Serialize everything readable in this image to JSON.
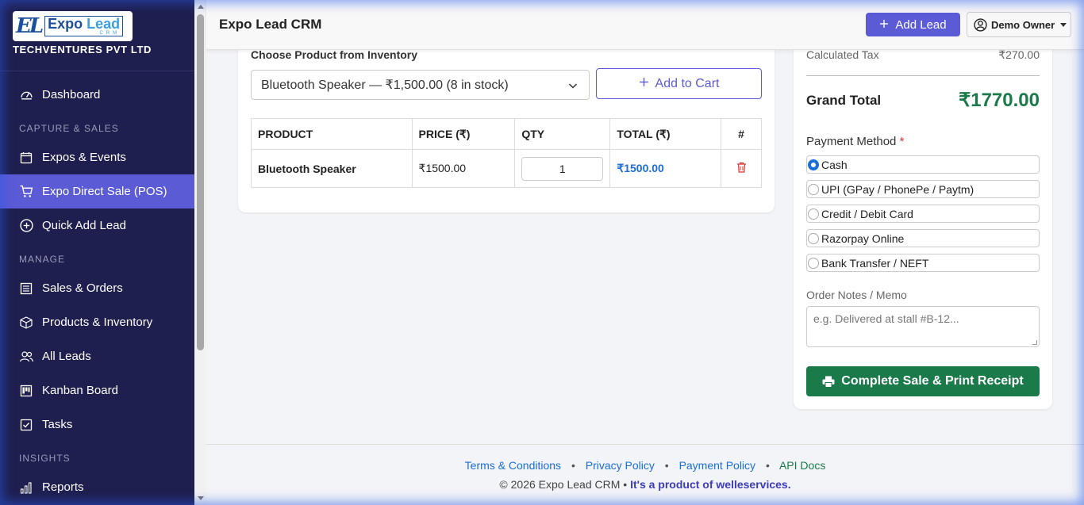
{
  "brand": {
    "logo_mark": "EL",
    "logo_main_a": "Expo ",
    "logo_main_b": "Lead",
    "logo_sub": "CRM",
    "company": "TECHVENTURES PVT LTD"
  },
  "sidebar": {
    "items": [
      {
        "label": "Dashboard",
        "icon": "dashboard-icon"
      },
      {
        "section": "CAPTURE & SALES"
      },
      {
        "label": "Expos & Events",
        "icon": "calendar-icon"
      },
      {
        "label": "Expo Direct Sale (POS)",
        "icon": "cart-icon",
        "active": true
      },
      {
        "label": "Quick Add Lead",
        "icon": "plus-circle-icon"
      },
      {
        "section": "MANAGE"
      },
      {
        "label": "Sales & Orders",
        "icon": "receipt-icon"
      },
      {
        "label": "Products & Inventory",
        "icon": "box-icon"
      },
      {
        "label": "All Leads",
        "icon": "people-icon"
      },
      {
        "label": "Kanban Board",
        "icon": "kanban-icon"
      },
      {
        "label": "Tasks",
        "icon": "check-square-icon"
      },
      {
        "section": "INSIGHTS"
      },
      {
        "label": "Reports",
        "icon": "bar-chart-icon"
      }
    ]
  },
  "header": {
    "title": "Expo Lead CRM",
    "add_lead_label": "Add Lead",
    "user_name": "Demo Owner"
  },
  "pos": {
    "choose_label": "Choose Product from Inventory",
    "selected_product": "Bluetooth Speaker — ₹1,500.00 (8 in stock)",
    "add_to_cart_label": "Add to Cart",
    "table": {
      "headers": [
        "PRODUCT",
        "PRICE (₹)",
        "QTY",
        "TOTAL (₹)",
        "#"
      ],
      "rows": [
        {
          "product": "Bluetooth Speaker",
          "price": "₹1500.00",
          "qty": "1",
          "total": "₹1500.00"
        }
      ]
    }
  },
  "summary": {
    "tax_label": "Calculated Tax",
    "tax_value": "₹270.00",
    "grand_total_label": "Grand Total",
    "grand_total_value": "₹1770.00",
    "payment_label": "Payment Method",
    "required_mark": "*",
    "payment_options": [
      {
        "label": "Cash",
        "selected": true
      },
      {
        "label": "UPI (GPay / PhonePe / Paytm)",
        "selected": false
      },
      {
        "label": "Credit / Debit Card",
        "selected": false
      },
      {
        "label": "Razorpay Online",
        "selected": false
      },
      {
        "label": "Bank Transfer / NEFT",
        "selected": false
      }
    ],
    "notes_label": "Order Notes / Memo",
    "notes_placeholder": "e.g. Delivered at stall #B-12...",
    "complete_label": "Complete Sale & Print Receipt"
  },
  "footer": {
    "links": [
      "Terms & Conditions",
      "Privacy Policy",
      "Payment Policy",
      "API Docs"
    ],
    "separator": "•",
    "copyright": "© 2026 Expo Lead CRM •",
    "product_of": "It's a product of welleservices."
  },
  "colors": {
    "sidebar_bg": "#1f1f4f",
    "accent": "#5b5bd6",
    "success": "#1a7a4a",
    "link": "#1a6ed8"
  }
}
